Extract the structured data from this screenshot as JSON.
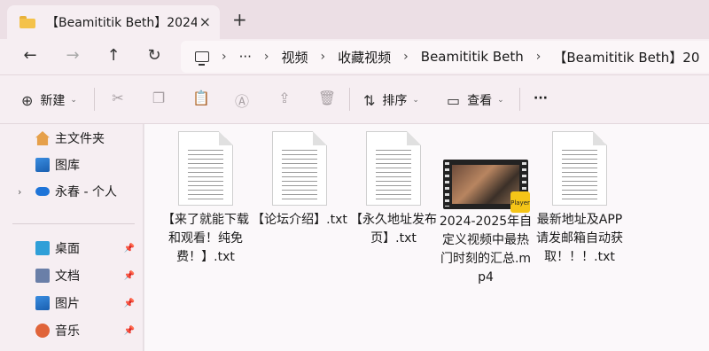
{
  "tab": {
    "title": "【Beamititik Beth】2024",
    "close_icon": "×",
    "new_tab_icon": "+"
  },
  "nav": {
    "back": "←",
    "forward": "→",
    "up": "↑",
    "refresh": "↻"
  },
  "breadcrumb": {
    "overflow": "···",
    "items": [
      "视频",
      "收藏视频",
      "Beamititik Beth",
      "【Beamititik Beth】20"
    ]
  },
  "toolbar": {
    "new_label": "新建",
    "sort_label": "排序",
    "view_label": "查看",
    "more_label": "···"
  },
  "sidebar": {
    "top_items": [
      {
        "label": "主文件夹",
        "icon": "home-icon"
      },
      {
        "label": "图库",
        "icon": "gallery-icon"
      },
      {
        "label": "永春 - 个人",
        "icon": "cloud-icon"
      }
    ],
    "pinned_items": [
      {
        "label": "桌面",
        "icon": "desktop-icon"
      },
      {
        "label": "文档",
        "icon": "documents-icon"
      },
      {
        "label": "图片",
        "icon": "pictures-icon"
      },
      {
        "label": "音乐",
        "icon": "music-icon"
      }
    ]
  },
  "files": [
    {
      "name": "【来了就能下载和观看！纯免费！】.txt",
      "type": "txt"
    },
    {
      "name": "【论坛介绍】.txt",
      "type": "txt"
    },
    {
      "name": "【永久地址发布页】.txt",
      "type": "txt"
    },
    {
      "name": "2024-2025年自定义视频中最热门时刻的汇总.mp4",
      "type": "mp4",
      "badge": "Player"
    },
    {
      "name": "最新地址及APP请发邮箱自动获取！！！.txt",
      "type": "txt"
    }
  ],
  "colors": {
    "accent": "#0067c0",
    "folder": "#f4c24a",
    "badge": "#f5c518"
  }
}
